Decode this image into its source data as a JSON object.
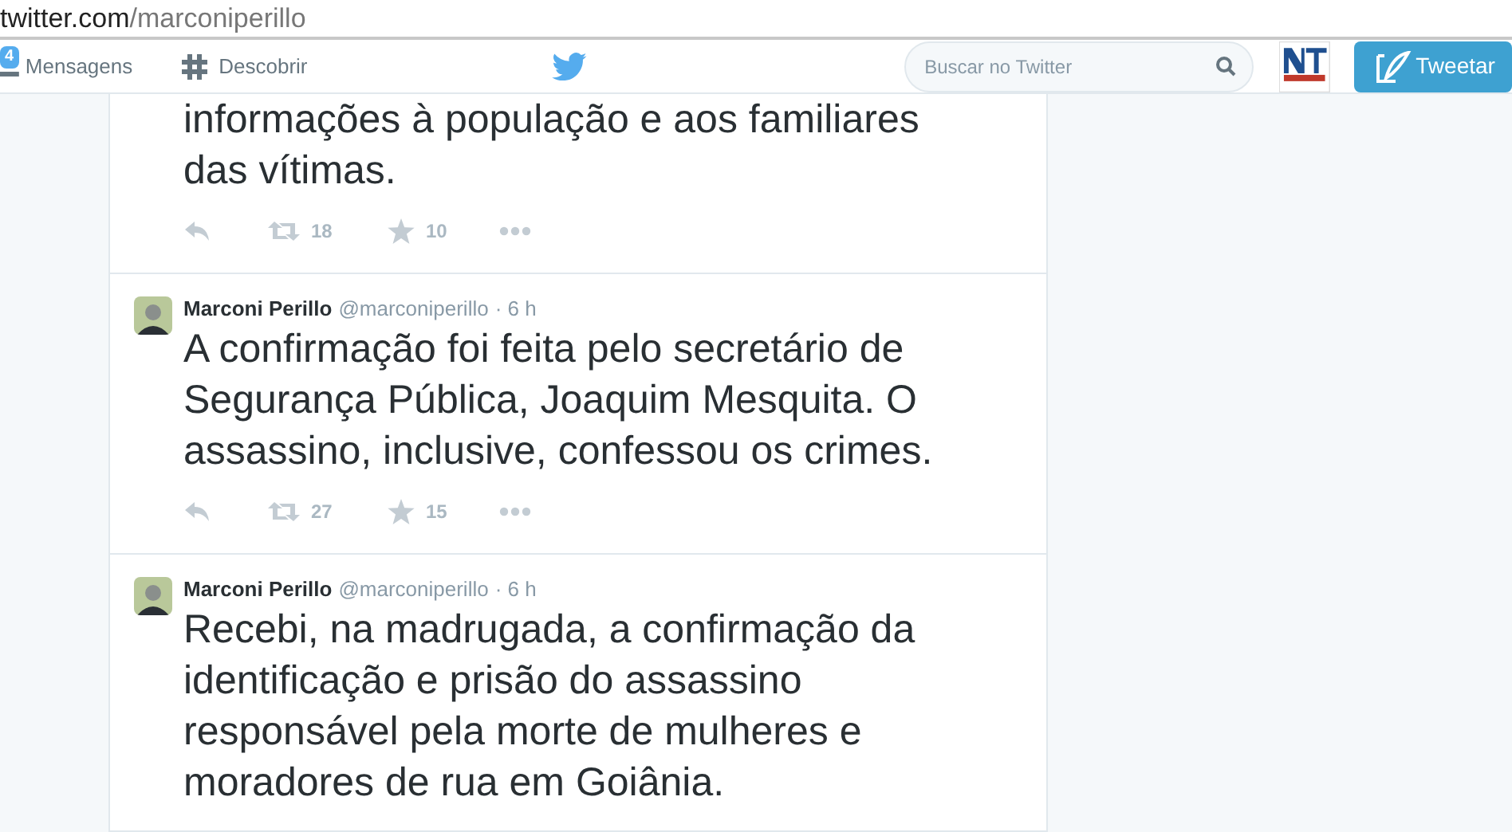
{
  "address_bar": {
    "host": "twitter.com",
    "path": "/marconiperillo"
  },
  "nav": {
    "messages": {
      "label": "Mensagens",
      "badge": "4"
    },
    "discover": {
      "label": "Descobrir"
    },
    "search": {
      "placeholder": "Buscar no Twitter"
    },
    "tweet_button": "Tweetar"
  },
  "tweets": [
    {
      "text": "informações à população e aos familiares das vítimas.",
      "retweets": "18",
      "favorites": "10"
    },
    {
      "author": "Marconi Perillo",
      "handle": "@marconiperillo",
      "time": "· 6 h",
      "text": "A confirmação foi feita pelo secretário de Segurança Pública, Joaquim Mesquita. O assassino, inclusive, confessou os crimes.",
      "retweets": "27",
      "favorites": "15"
    },
    {
      "author": "Marconi Perillo",
      "handle": "@marconiperillo",
      "time": "· 6 h",
      "text": "Recebi, na madrugada, a confirmação da identificação e prisão do assassino responsável pela morte de mulheres e moradores de rua em Goiânia."
    }
  ]
}
